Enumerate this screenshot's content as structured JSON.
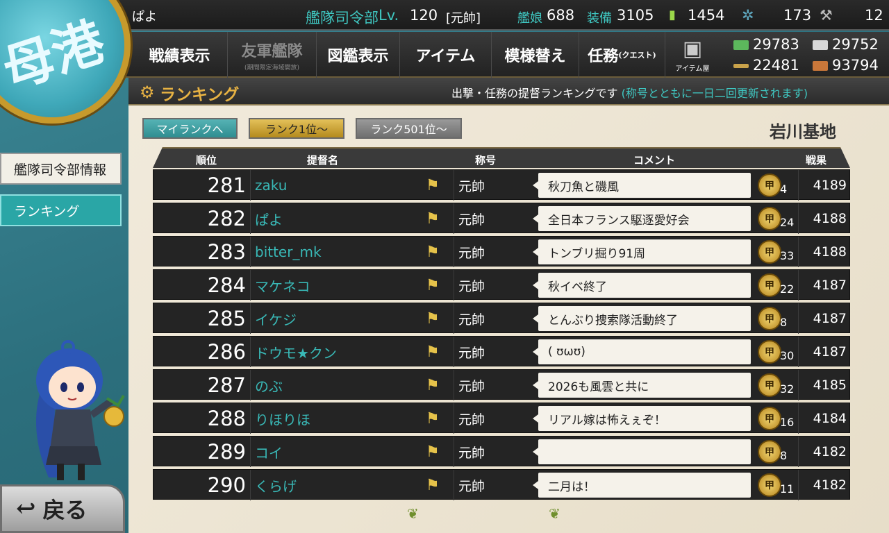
{
  "statusbar": {
    "player_name": "ぱよ",
    "hq_label": "艦隊司令部",
    "level_prefix": "Lv.",
    "level": "120",
    "rank": "[元帥]",
    "ships_label": "艦娘",
    "ships": "688",
    "equip_label": "装備",
    "equip": "3105",
    "buckets": "1454",
    "dev_materials": "173",
    "screws": "12"
  },
  "menu": {
    "items": [
      {
        "label": "戦績表示"
      },
      {
        "label": "友軍艦隊",
        "sub": "(期間限定海域開放)"
      },
      {
        "label": "図鑑表示"
      },
      {
        "label": "アイテム"
      },
      {
        "label": "模様替え"
      },
      {
        "label": "任務",
        "sub": "(クエスト)"
      }
    ],
    "shop_label": "アイテム屋"
  },
  "resources": {
    "fuel": "29783",
    "ammo": "29752",
    "steel": "22481",
    "bauxite": "93794"
  },
  "titlebar": {
    "title": "ランキング",
    "desc": "出撃・任務の提督ランキングです",
    "note": "(称号とともに一日二回更新されます)"
  },
  "side": {
    "info": "艦隊司令部情報",
    "ranking": "ランキング"
  },
  "tabs": {
    "my_rank": "マイランクへ",
    "rank1": "ランク1位～",
    "rank501": "ランク501位～"
  },
  "base_name": "岩川基地",
  "table": {
    "headers": {
      "rank": "順位",
      "name": "提督名",
      "title": "称号",
      "comment": "コメント",
      "score": "戦果"
    },
    "rows": [
      {
        "rank": "281",
        "name": "zaku",
        "title": "元帥",
        "comment": "秋刀魚と磯風",
        "medal": "4",
        "score": "4189"
      },
      {
        "rank": "282",
        "name": "ぱよ",
        "title": "元帥",
        "comment": "全日本フランス駆逐愛好会",
        "medal": "24",
        "score": "4188"
      },
      {
        "rank": "283",
        "name": "bitter_mk",
        "title": "元帥",
        "comment": "トンブリ掘り91周",
        "medal": "33",
        "score": "4188"
      },
      {
        "rank": "284",
        "name": "マケネコ",
        "title": "元帥",
        "comment": "秋イベ終了",
        "medal": "22",
        "score": "4187"
      },
      {
        "rank": "285",
        "name": "イケジ",
        "title": "元帥",
        "comment": "とんぶり捜索隊活動終了",
        "medal": "8",
        "score": "4187"
      },
      {
        "rank": "286",
        "name": "ドウモ★クン",
        "title": "元帥",
        "comment": "( ʊωʊ)",
        "medal": "30",
        "score": "4187"
      },
      {
        "rank": "287",
        "name": "のぶ",
        "title": "元帥",
        "comment": "2026も風雲と共に",
        "medal": "32",
        "score": "4185"
      },
      {
        "rank": "288",
        "name": "りほりほ",
        "title": "元帥",
        "comment": "リアル嫁は怖えぇぞ！",
        "medal": "16",
        "score": "4184"
      },
      {
        "rank": "289",
        "name": "コイ",
        "title": "元帥",
        "comment": "",
        "medal": "8",
        "score": "4182"
      },
      {
        "rank": "290",
        "name": "くらげ",
        "title": "元帥",
        "comment": "二月は！",
        "medal": "11",
        "score": "4182"
      }
    ]
  },
  "medal_glyph": "甲",
  "back_label": "戻る",
  "colors": {
    "accent": "#3fc7c1",
    "gold": "#e7b243",
    "name": "#39b8b6"
  }
}
